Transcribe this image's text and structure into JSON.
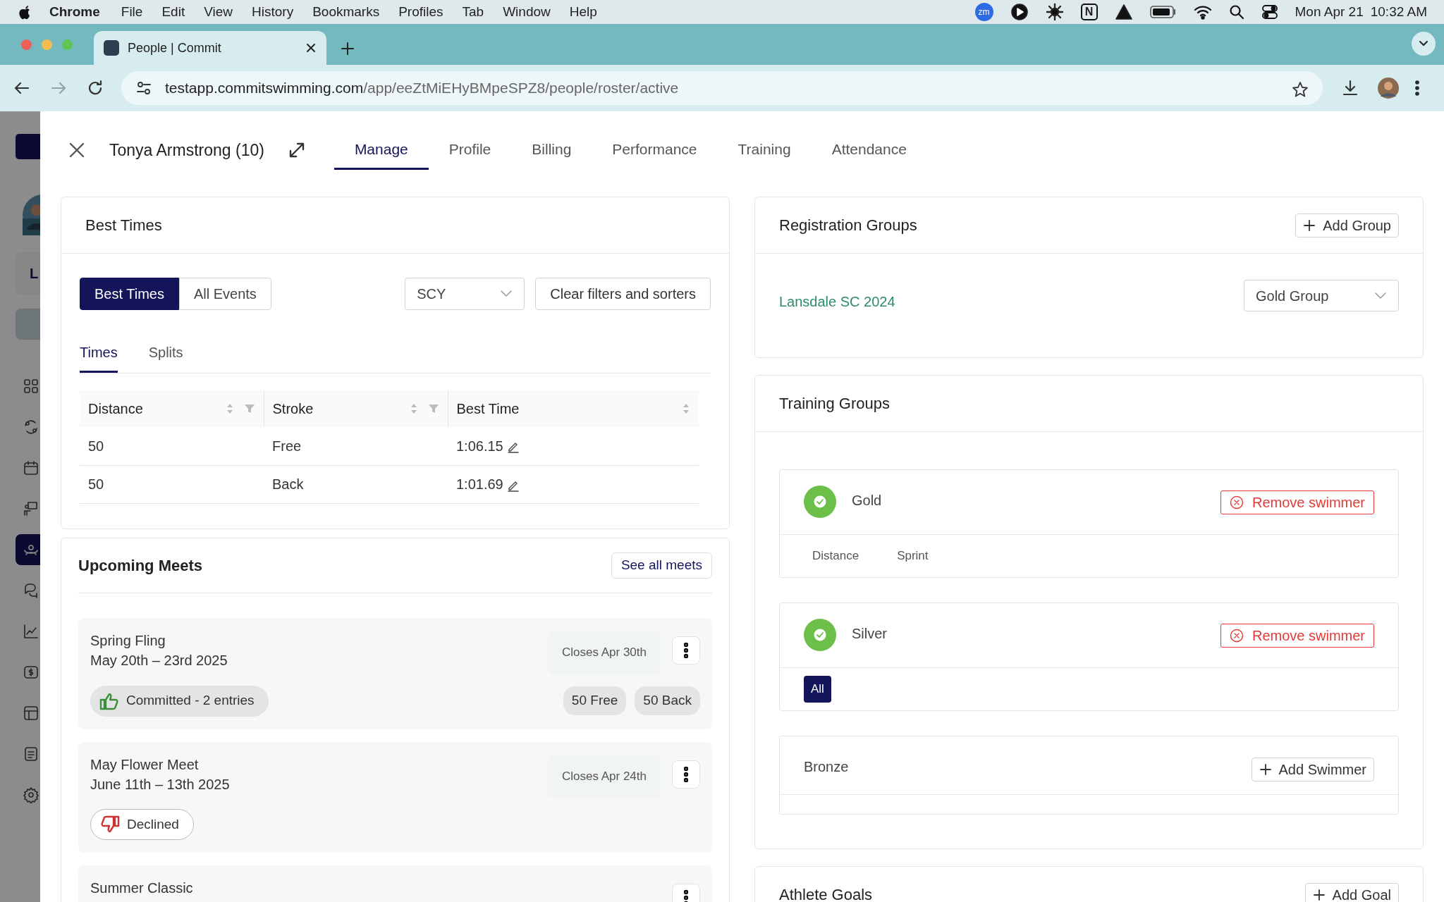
{
  "menu_bar": {
    "app": "Chrome",
    "items": [
      "File",
      "Edit",
      "View",
      "History",
      "Bookmarks",
      "Profiles",
      "Tab",
      "Window",
      "Help"
    ],
    "zoom_badge": "zm",
    "notion_badge": "N",
    "date": "Mon Apr 21",
    "time": "10:32 AM"
  },
  "browser": {
    "tabs": [
      {
        "title": "People | Commit",
        "selected": true
      }
    ],
    "url": {
      "host": "testapp.commitswimming.com",
      "path": "/app/eeZtMiEHyBMpeSPZ8/people/roster/active"
    }
  },
  "sidebar": {
    "label": "L",
    "items": [
      {
        "kind": "grid",
        "selected": false
      },
      {
        "kind": "swap",
        "selected": false
      },
      {
        "kind": "calendar",
        "selected": false
      },
      {
        "kind": "presenter",
        "selected": false
      },
      {
        "kind": "team",
        "selected": true
      },
      {
        "kind": "chat",
        "selected": false
      },
      {
        "kind": "chart",
        "selected": false
      },
      {
        "kind": "dollar",
        "selected": false
      },
      {
        "kind": "table",
        "selected": false
      },
      {
        "kind": "notes",
        "selected": false
      },
      {
        "kind": "gear",
        "selected": false
      }
    ]
  },
  "drawer": {
    "title": "Tonya Armstrong (10)",
    "tabs": [
      {
        "label": "Manage",
        "selected": true
      },
      {
        "label": "Profile",
        "selected": false
      },
      {
        "label": "Billing",
        "selected": false
      },
      {
        "label": "Performance",
        "selected": false
      },
      {
        "label": "Training",
        "selected": false
      },
      {
        "label": "Attendance",
        "selected": false
      }
    ]
  },
  "best_times": {
    "title": "Best Times",
    "modes": [
      {
        "label": "Best Times",
        "selected": true
      },
      {
        "label": "All Events",
        "selected": false
      }
    ],
    "course": "SCY",
    "clear_button": "Clear filters and sorters",
    "subtabs": [
      {
        "label": "Times",
        "selected": true
      },
      {
        "label": "Splits",
        "selected": false
      }
    ],
    "table": {
      "columns": [
        {
          "label": "Distance",
          "filterable": true
        },
        {
          "label": "Stroke",
          "filterable": true
        },
        {
          "label": "Best Time",
          "filterable": false
        }
      ],
      "rows": [
        [
          "50",
          "Free",
          "1:06.15"
        ],
        [
          "50",
          "Back",
          "1:01.69"
        ]
      ]
    }
  },
  "upcoming_meets": {
    "title": "Upcoming Meets",
    "see_all": "See all meets",
    "meets": [
      {
        "name": "Spring Fling",
        "dates": "May 20th – 23rd 2025",
        "closes": "Closes Apr 30th",
        "status": {
          "kind": "committed",
          "label": "Committed - 2 entries"
        },
        "events": [
          "50 Free",
          "50 Back"
        ]
      },
      {
        "name": "May Flower Meet",
        "dates": "June 11th – 13th 2025",
        "closes": "Closes Apr 24th",
        "status": {
          "kind": "declined",
          "label": "Declined"
        }
      },
      {
        "name": "Summer Classic"
      }
    ]
  },
  "registration_groups": {
    "title": "Registration Groups",
    "add_button": "Add Group",
    "items": [
      {
        "name": "Lansdale SC 2024",
        "group": "Gold Group"
      }
    ]
  },
  "training_groups": {
    "title": "Training Groups",
    "groups": [
      {
        "name": "Gold",
        "member": true,
        "action": "Remove swimmer",
        "subgroups": [
          {
            "label": "Distance",
            "selected": false
          },
          {
            "label": "Sprint",
            "selected": false
          }
        ]
      },
      {
        "name": "Silver",
        "member": true,
        "action": "Remove swimmer",
        "subgroups": [
          {
            "label": "All",
            "selected": true
          }
        ]
      },
      {
        "name": "Bronze",
        "member": false,
        "action": "Add Swimmer"
      }
    ]
  },
  "athlete_goals": {
    "title": "Athlete Goals",
    "add_button": "Add Goal"
  }
}
